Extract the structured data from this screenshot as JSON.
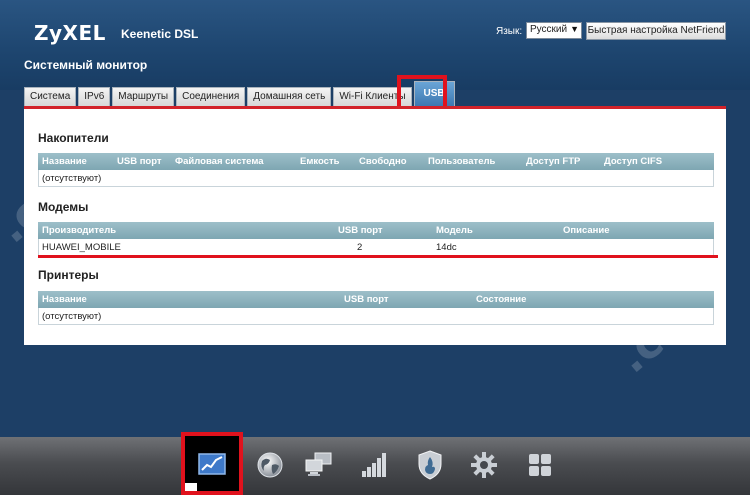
{
  "header": {
    "logo": "ZyXEL",
    "model": "Keenetic DSL",
    "language_label": "Язык:",
    "language_value": "Русский",
    "quick_setup": "Быстрая настройка NetFriend"
  },
  "page_title": "Системный монитор",
  "tabs": [
    {
      "label": "Система"
    },
    {
      "label": "IPv6"
    },
    {
      "label": "Маршруты"
    },
    {
      "label": "Соединения"
    },
    {
      "label": "Домашняя сеть"
    },
    {
      "label": "Wi-Fi Клиенты"
    },
    {
      "label": "USB",
      "active": true
    }
  ],
  "storage": {
    "title": "Накопители",
    "columns": [
      "Название",
      "USB порт",
      "Файловая система",
      "Емкость",
      "Свободно",
      "Пользователь",
      "Доступ FTP",
      "Доступ CIFS"
    ],
    "empty": "(отсутствуют)"
  },
  "modems": {
    "title": "Модемы",
    "columns": [
      "Производитель",
      "USB порт",
      "Модель",
      "Описание"
    ],
    "rows": [
      {
        "vendor": "HUAWEI_MOBILE",
        "port": "2",
        "model": "14dc",
        "description": ""
      }
    ]
  },
  "printers": {
    "title": "Принтеры",
    "columns": [
      "Название",
      "USB порт",
      "Состояние"
    ],
    "empty": "(отсутствуют)"
  },
  "footer_nav": [
    {
      "icon": "monitor-chart-icon",
      "active": true
    },
    {
      "icon": "globe-icon"
    },
    {
      "icon": "network-computers-icon"
    },
    {
      "icon": "signal-bars-icon"
    },
    {
      "icon": "shield-icon"
    },
    {
      "icon": "gear-icon"
    },
    {
      "icon": "apps-grid-icon"
    }
  ],
  "colors": {
    "header_blue": "#1e4670",
    "accent_red": "#e0121d",
    "table_header": "#8fb3bd",
    "tab_active": "#4f8cc4"
  }
}
